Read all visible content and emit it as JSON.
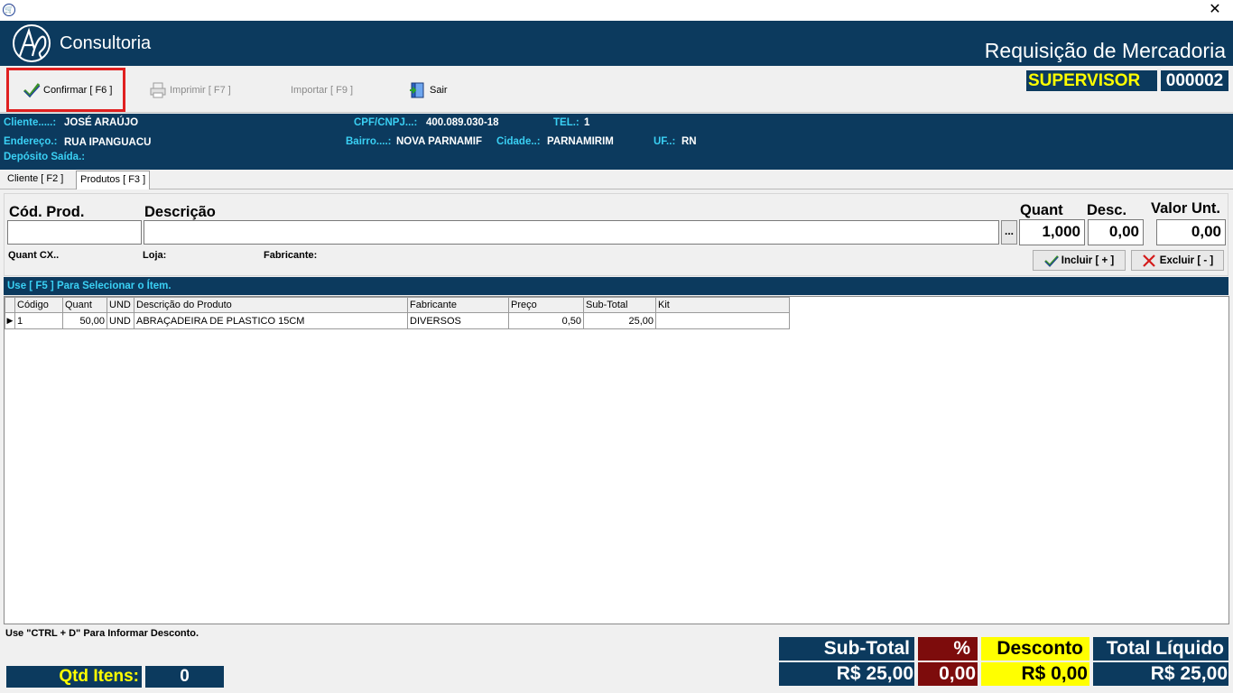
{
  "window": {
    "close_icon": "close-icon",
    "app_icon": "cart-icon"
  },
  "header": {
    "brand": "Consultoria",
    "title": "Requisição de Mercadoria"
  },
  "toolbar": {
    "confirm": "Confirmar [ F6 ]",
    "print": "Imprimir  [ F7 ]",
    "import": "Importar  [ F9 ]",
    "exit": "Sair",
    "user": "SUPERVISOR",
    "doc_number": "000002"
  },
  "client": {
    "cliente_label": "Cliente.....:",
    "cliente_value": "JOSÉ ARAÚJO",
    "cpf_label": "CPF/CNPJ...:",
    "cpf_value": "400.089.030-18",
    "tel_label": "TEL.:",
    "tel_value": "1",
    "endereco_label": "Endereço.:",
    "endereco_value": "RUA IPANGUACU",
    "bairro_label": "Bairro....:",
    "bairro_value": "NOVA PARNAMIF",
    "cidade_label": "Cidade..:",
    "cidade_value": "PARNAMIRIM",
    "uf_label": "UF..:",
    "uf_value": "RN",
    "deposito_label": "Depósito Saída.:"
  },
  "tabs": [
    {
      "label": "Cliente [ F2 ]"
    },
    {
      "label": "Produtos [ F3 ]"
    }
  ],
  "entry": {
    "cod_label": "Cód. Prod.",
    "desc_label": "Descrição",
    "quant_label": "Quant",
    "desc_pct_label": "Desc.",
    "valor_label": "Valor Unt.",
    "cod_value": "",
    "desc_value": "",
    "quant_value": "1,000",
    "desconto_value": "0,00",
    "valor_value": "0,00",
    "dots": "...",
    "quant_cx_label": "Quant CX..",
    "loja_label": "Loja:",
    "fabricante_label": "Fabricante:",
    "include_btn": "Incluir [ + ]",
    "exclude_btn": "Excluir [ - ]"
  },
  "hint": "Use [ F5 ] Para Selecionar o Ítem.",
  "grid": {
    "columns": [
      "Código",
      "Quant",
      "UND",
      "Descrição do Produto",
      "Fabricante",
      "Preço",
      "Sub-Total",
      "Kit"
    ],
    "rows": [
      [
        "1",
        "50,00",
        "UND",
        "ABRAÇADEIRA DE PLASTICO 15CM",
        "DIVERSOS",
        "0,50",
        "25,00",
        ""
      ]
    ]
  },
  "footer": {
    "ctrl_hint": "Use \"CTRL + D\" Para Informar Desconto.",
    "qtd_label": "Qtd Itens:",
    "qtd_value": "0",
    "subtotal_label": "Sub-Total",
    "subtotal_value": "R$ 25,00",
    "pct_label": "%",
    "pct_value": "0,00",
    "desconto_label": "Desconto",
    "desconto_value": "R$ 0,00",
    "total_label": "Total Líquido",
    "total_value": "R$ 25,00"
  },
  "colors": {
    "navy": "#0c3a5e",
    "cyan_label": "#3ad0f4",
    "yellow": "#ffff00",
    "maroon": "#7d0c0c",
    "highlight": "#e02020"
  }
}
